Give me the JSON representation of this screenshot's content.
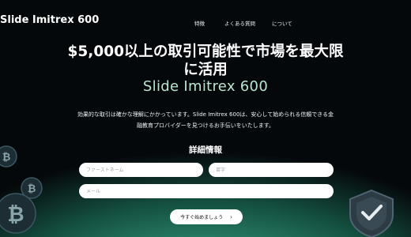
{
  "header": {
    "logo": "Slide Imitrex 600",
    "nav": [
      "特徴",
      "よくある質問",
      "について"
    ]
  },
  "hero": {
    "headline_line1": "$5,000以上の取引可能性で市場を最大限",
    "headline_line2": "に活用",
    "brand": "Slide Imitrex 600",
    "description_line1": "効果的な取引は確かな理解にかかっています。Slide Imitrex 600は、安心して始められる信頼できる金",
    "description_line2": "融教育プロバイダーを見つけるお手伝いをいたします。"
  },
  "form": {
    "title": "詳細情報",
    "first_name_placeholder": "ファーストネーム",
    "last_name_placeholder": "苗字",
    "email_placeholder": "メール",
    "submit_label": "今すぐ始めましょう",
    "submit_icon": "chevron-right-icon"
  },
  "decorations": {
    "left": "bitcoin-coins-icon",
    "right": "shield-check-icon"
  }
}
